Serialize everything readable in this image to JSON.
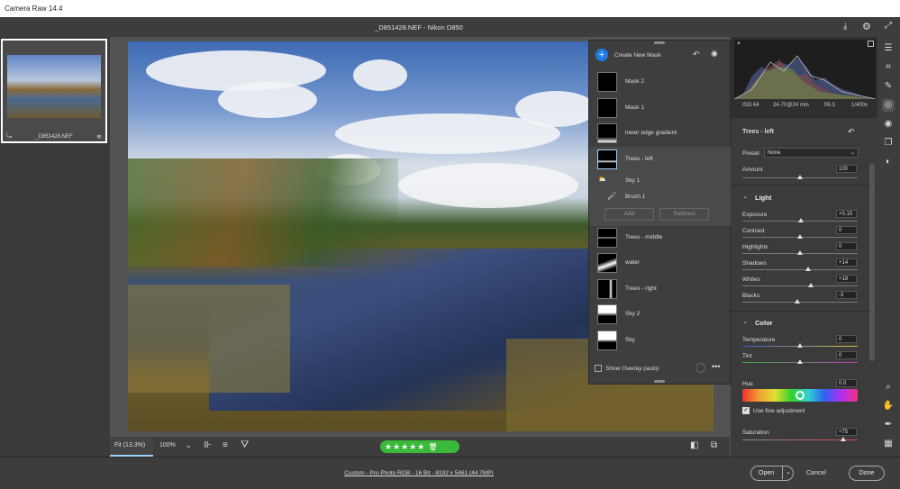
{
  "app": {
    "title": "Camera Raw 14.4"
  },
  "header": {
    "file_title": "_D851428.NEF  -  Nikon D850"
  },
  "filmstrip": {
    "filename": "_D851428.NEF"
  },
  "canvas_bar": {
    "fit_label": "Fit (13.3%)",
    "zoom_label": "100%",
    "stars": "★★★★★"
  },
  "masks": {
    "create_label": "Create New Mask",
    "items": [
      {
        "label": "Mask 2"
      },
      {
        "label": "Mask 1"
      },
      {
        "label": "lower edge gradient"
      },
      {
        "label": "Trees - left"
      },
      {
        "label": "Trees - middle"
      },
      {
        "label": "water"
      },
      {
        "label": "Trees - right"
      },
      {
        "label": "Sky 2"
      },
      {
        "label": "Sky"
      }
    ],
    "sub_items": [
      {
        "label": "Sky 1"
      },
      {
        "label": "Brush 1"
      }
    ],
    "add_label": "Add",
    "subtract_label": "Subtract",
    "overlay_label": "Show Overlay (auto)"
  },
  "camera_info": {
    "iso": "ISO 64",
    "lens": "24-70@24 mm",
    "aperture": "f/6.3",
    "shutter": "1/400s"
  },
  "properties": {
    "mask_name": "Trees - left",
    "preset_label": "Preset",
    "preset_value": "None",
    "amount_label": "Amount",
    "amount_value": "100",
    "light_section": "Light",
    "light": [
      {
        "label": "Exposure",
        "value": "+0.10",
        "pos": 0.51
      },
      {
        "label": "Contrast",
        "value": "0",
        "pos": 0.5
      },
      {
        "label": "Highlights",
        "value": "0",
        "pos": 0.5
      },
      {
        "label": "Shadows",
        "value": "+14",
        "pos": 0.57
      },
      {
        "label": "Whites",
        "value": "+18",
        "pos": 0.59
      },
      {
        "label": "Blacks",
        "value": "-3",
        "pos": 0.48
      }
    ],
    "color_section": "Color",
    "temperature_label": "Temperature",
    "temperature_value": "0",
    "tint_label": "Tint",
    "tint_value": "0",
    "hue_label": "Hue",
    "hue_value": "0.0",
    "fine_adjust_label": "Use fine adjustment",
    "saturation_label": "Saturation",
    "saturation_value": "+75"
  },
  "footer": {
    "info": "Custom - Pro Photo RGB - 16 Bit - 8192 x 5461 (44.7MP)",
    "open_label": "Open",
    "cancel_label": "Cancel",
    "done_label": "Done"
  }
}
